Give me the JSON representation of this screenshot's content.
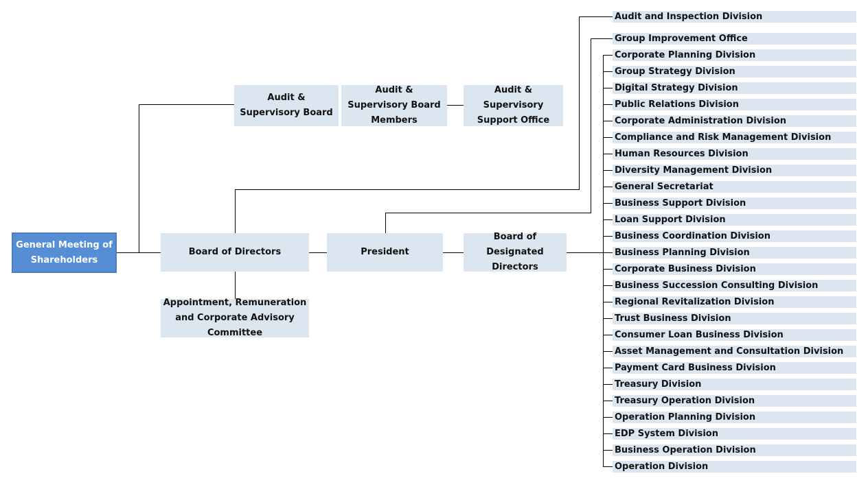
{
  "colors": {
    "primary_box": "#558ed5",
    "secondary_box": "#dce6f1",
    "line": "#000000"
  },
  "nodes": {
    "shareholders": "General Meeting of Shareholders",
    "audit_board": "Audit & Supervisory Board",
    "audit_members": "Audit & Supervisory Board Members",
    "audit_office": "Audit & Supervisory Support Office",
    "board": "Board of Directors",
    "committee": "Appointment, Remuneration and Corporate Advisory Committee",
    "president": "President",
    "designated": "Board of Designated Directors",
    "audit_inspection": "Audit and Inspection Division",
    "group_improvement": "Group Improvement Office"
  },
  "divisions": [
    "Corporate Planning Division",
    "Group Strategy Division",
    "Digital Strategy Division",
    "Public Relations Division",
    "Corporate Administration Division",
    "Compliance and Risk Management Division",
    "Human Resources Division",
    "Diversity Management Division",
    "General Secretariat",
    "Business Support Division",
    "Loan Support Division",
    "Business Coordination Division",
    "Business Planning Division",
    "Corporate Business Division",
    "Business Succession Consulting Division",
    "Regional Revitalization Division",
    "Trust Business Division",
    "Consumer Loan Business Division",
    "Asset Management and Consultation Division",
    "Payment Card Business Division",
    "Treasury Division",
    "Treasury Operation Division",
    "Operation Planning Division",
    "EDP System Division",
    "Business Operation Division",
    "Operation Division"
  ]
}
